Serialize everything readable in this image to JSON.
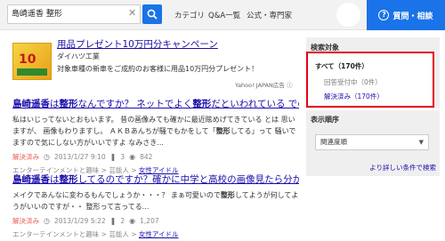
{
  "header": {
    "search_value": "島崎遥香 整形",
    "nav": [
      "カテゴリ",
      "Q&A一覧",
      "公式・専門家"
    ],
    "ask_label": "質問・相談"
  },
  "ad": {
    "thumb_text": "10",
    "title": "用品プレゼント10万円分キャンペーン",
    "sponsor": "ダイハツ工業",
    "desc": "対象車種の新車をご成約のお客様に用品10万円分プレゼント！",
    "label": "Yahoo! JAPAN広告",
    "info_icon": "ⓘ"
  },
  "results": [
    {
      "title_a": "島崎遥香",
      "title_b": "は",
      "title_c": "整形",
      "title_d": "なんですか？ ネットでよく",
      "title_e": "整形",
      "title_f": "だといわれている での 気になる",
      "snippet_a": "私はいじってないとおもいます。 昔の画像みても確かに最近眩めげてきている とは 思いますが、 画像もわりますし。 ＡＫＢあんちが騒でもかをして「",
      "snippet_b": "整形",
      "snippet_c": "してる」って 騒いでますので気にしない方がいいですよ なみさき...",
      "status": "解決済み",
      "date": "2013/1/27 9:10",
      "answers": "3",
      "views": "842",
      "cat_a": "エンターテインメントと趣味",
      "cat_b": "芸能人",
      "cat_c": "女性アイドル"
    },
    {
      "title_a": "島崎遥香",
      "title_b": "は",
      "title_c": "整形",
      "title_d": "してるのですか？確かに中学と高校の画像見たら分かり違い...",
      "snippet_a": "メイクであんなに変わるもんでしょうか・・・？ まぁ可愛いので",
      "snippet_b": "整形",
      "snippet_c": "してようが何してようがいいのですが・・ 整形って言ってる...",
      "status": "解決済み",
      "date": "2013/1/29 5:22",
      "answers": "2",
      "views": "1,207",
      "cat_a": "エンターテインメントと趣味",
      "cat_b": "芸能人",
      "cat_c": "女性アイドル"
    }
  ],
  "sidebar": {
    "filter_heading": "検索対象",
    "filters": [
      "すべて（170件）",
      "回答受付中（0件）",
      "解決済み（170件）"
    ],
    "order_heading": "表示順序",
    "order_value": "関連度順",
    "more_link": "より詳しい条件で検索"
  },
  "colors": {
    "accent": "#1a73e8",
    "link": "#1a0dab",
    "highlight_border": "#e60012",
    "solved": "#e85b5b"
  }
}
